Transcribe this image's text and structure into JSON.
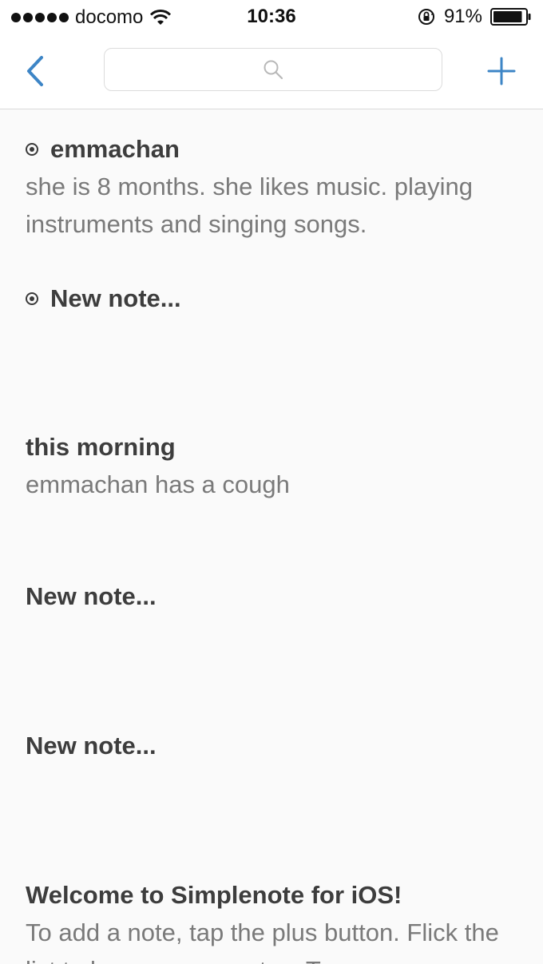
{
  "status_bar": {
    "carrier": "docomo",
    "time": "10:36",
    "battery_percent": "91%",
    "battery_level": 0.91
  },
  "nav": {
    "back_icon": "chevron-left-icon",
    "search_icon": "search-icon",
    "search_placeholder": "",
    "add_icon": "plus-icon",
    "accent_color": "#3d85c6"
  },
  "notes": [
    {
      "title": "emmachan",
      "body": "she is 8 months.  she likes music. playing instruments and singing songs.",
      "pinned": true
    },
    {
      "title": "New note...",
      "body": "",
      "pinned": true
    },
    {
      "title": "this morning",
      "body": "emmachan has a cough",
      "pinned": false
    },
    {
      "title": "New note...",
      "body": "",
      "pinned": false
    },
    {
      "title": "New note...",
      "body": "",
      "pinned": false
    },
    {
      "title": "Welcome to Simplenote for iOS!",
      "body": "To add a note, tap the plus button. Flick the list to browse your notes. To",
      "pinned": false
    }
  ]
}
